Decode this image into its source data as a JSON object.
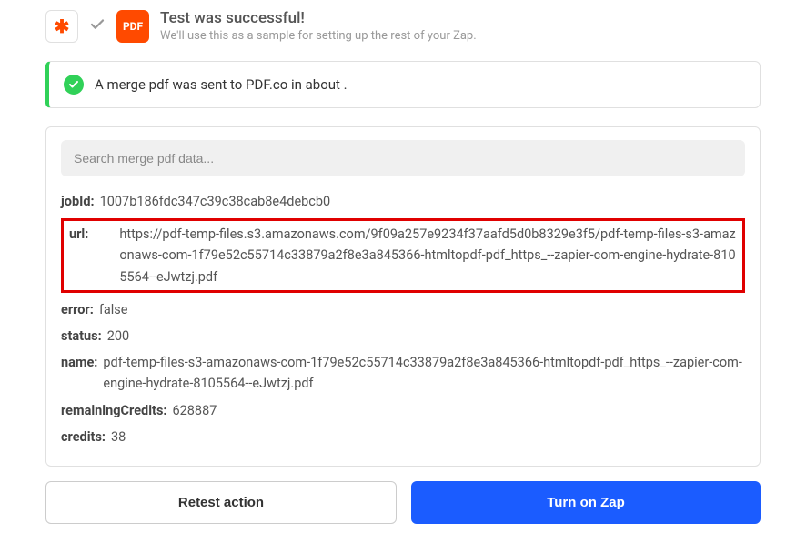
{
  "header": {
    "zapier_icon": "✱",
    "pdf_label": "PDF",
    "title": "Test was successful!",
    "subtitle": "We'll use this as a sample for setting up the rest of your Zap."
  },
  "status": {
    "message": "A merge pdf was sent to PDF.co in about ."
  },
  "search": {
    "placeholder": "Search merge pdf data..."
  },
  "result": {
    "jobId_label": "jobId:",
    "jobId": "1007b186fdc347c39c38cab8e4debcb0",
    "url_label": "url:",
    "url": "https://pdf-temp-files.s3.amazonaws.com/9f09a257e9234f37aafd5d0b8329e3f5/pdf-temp-files-s3-amazonaws-com-1f79e52c55714c33879a2f8e3a845366-htmltopdf-pdf_https_--zapier-com-engine-hydrate-8105564--eJwtzj.pdf",
    "error_label": "error:",
    "error": "false",
    "status_label": "status:",
    "status": "200",
    "name_label": "name:",
    "name": "pdf-temp-files-s3-amazonaws-com-1f79e52c55714c33879a2f8e3a845366-htmltopdf-pdf_https_--zapier-com-engine-hydrate-8105564--eJwtzj.pdf",
    "remainingCredits_label": "remainingCredits:",
    "remainingCredits": "628887",
    "credits_label": "credits:",
    "credits": "38"
  },
  "actions": {
    "retest": "Retest action",
    "turn_on": "Turn on Zap"
  }
}
